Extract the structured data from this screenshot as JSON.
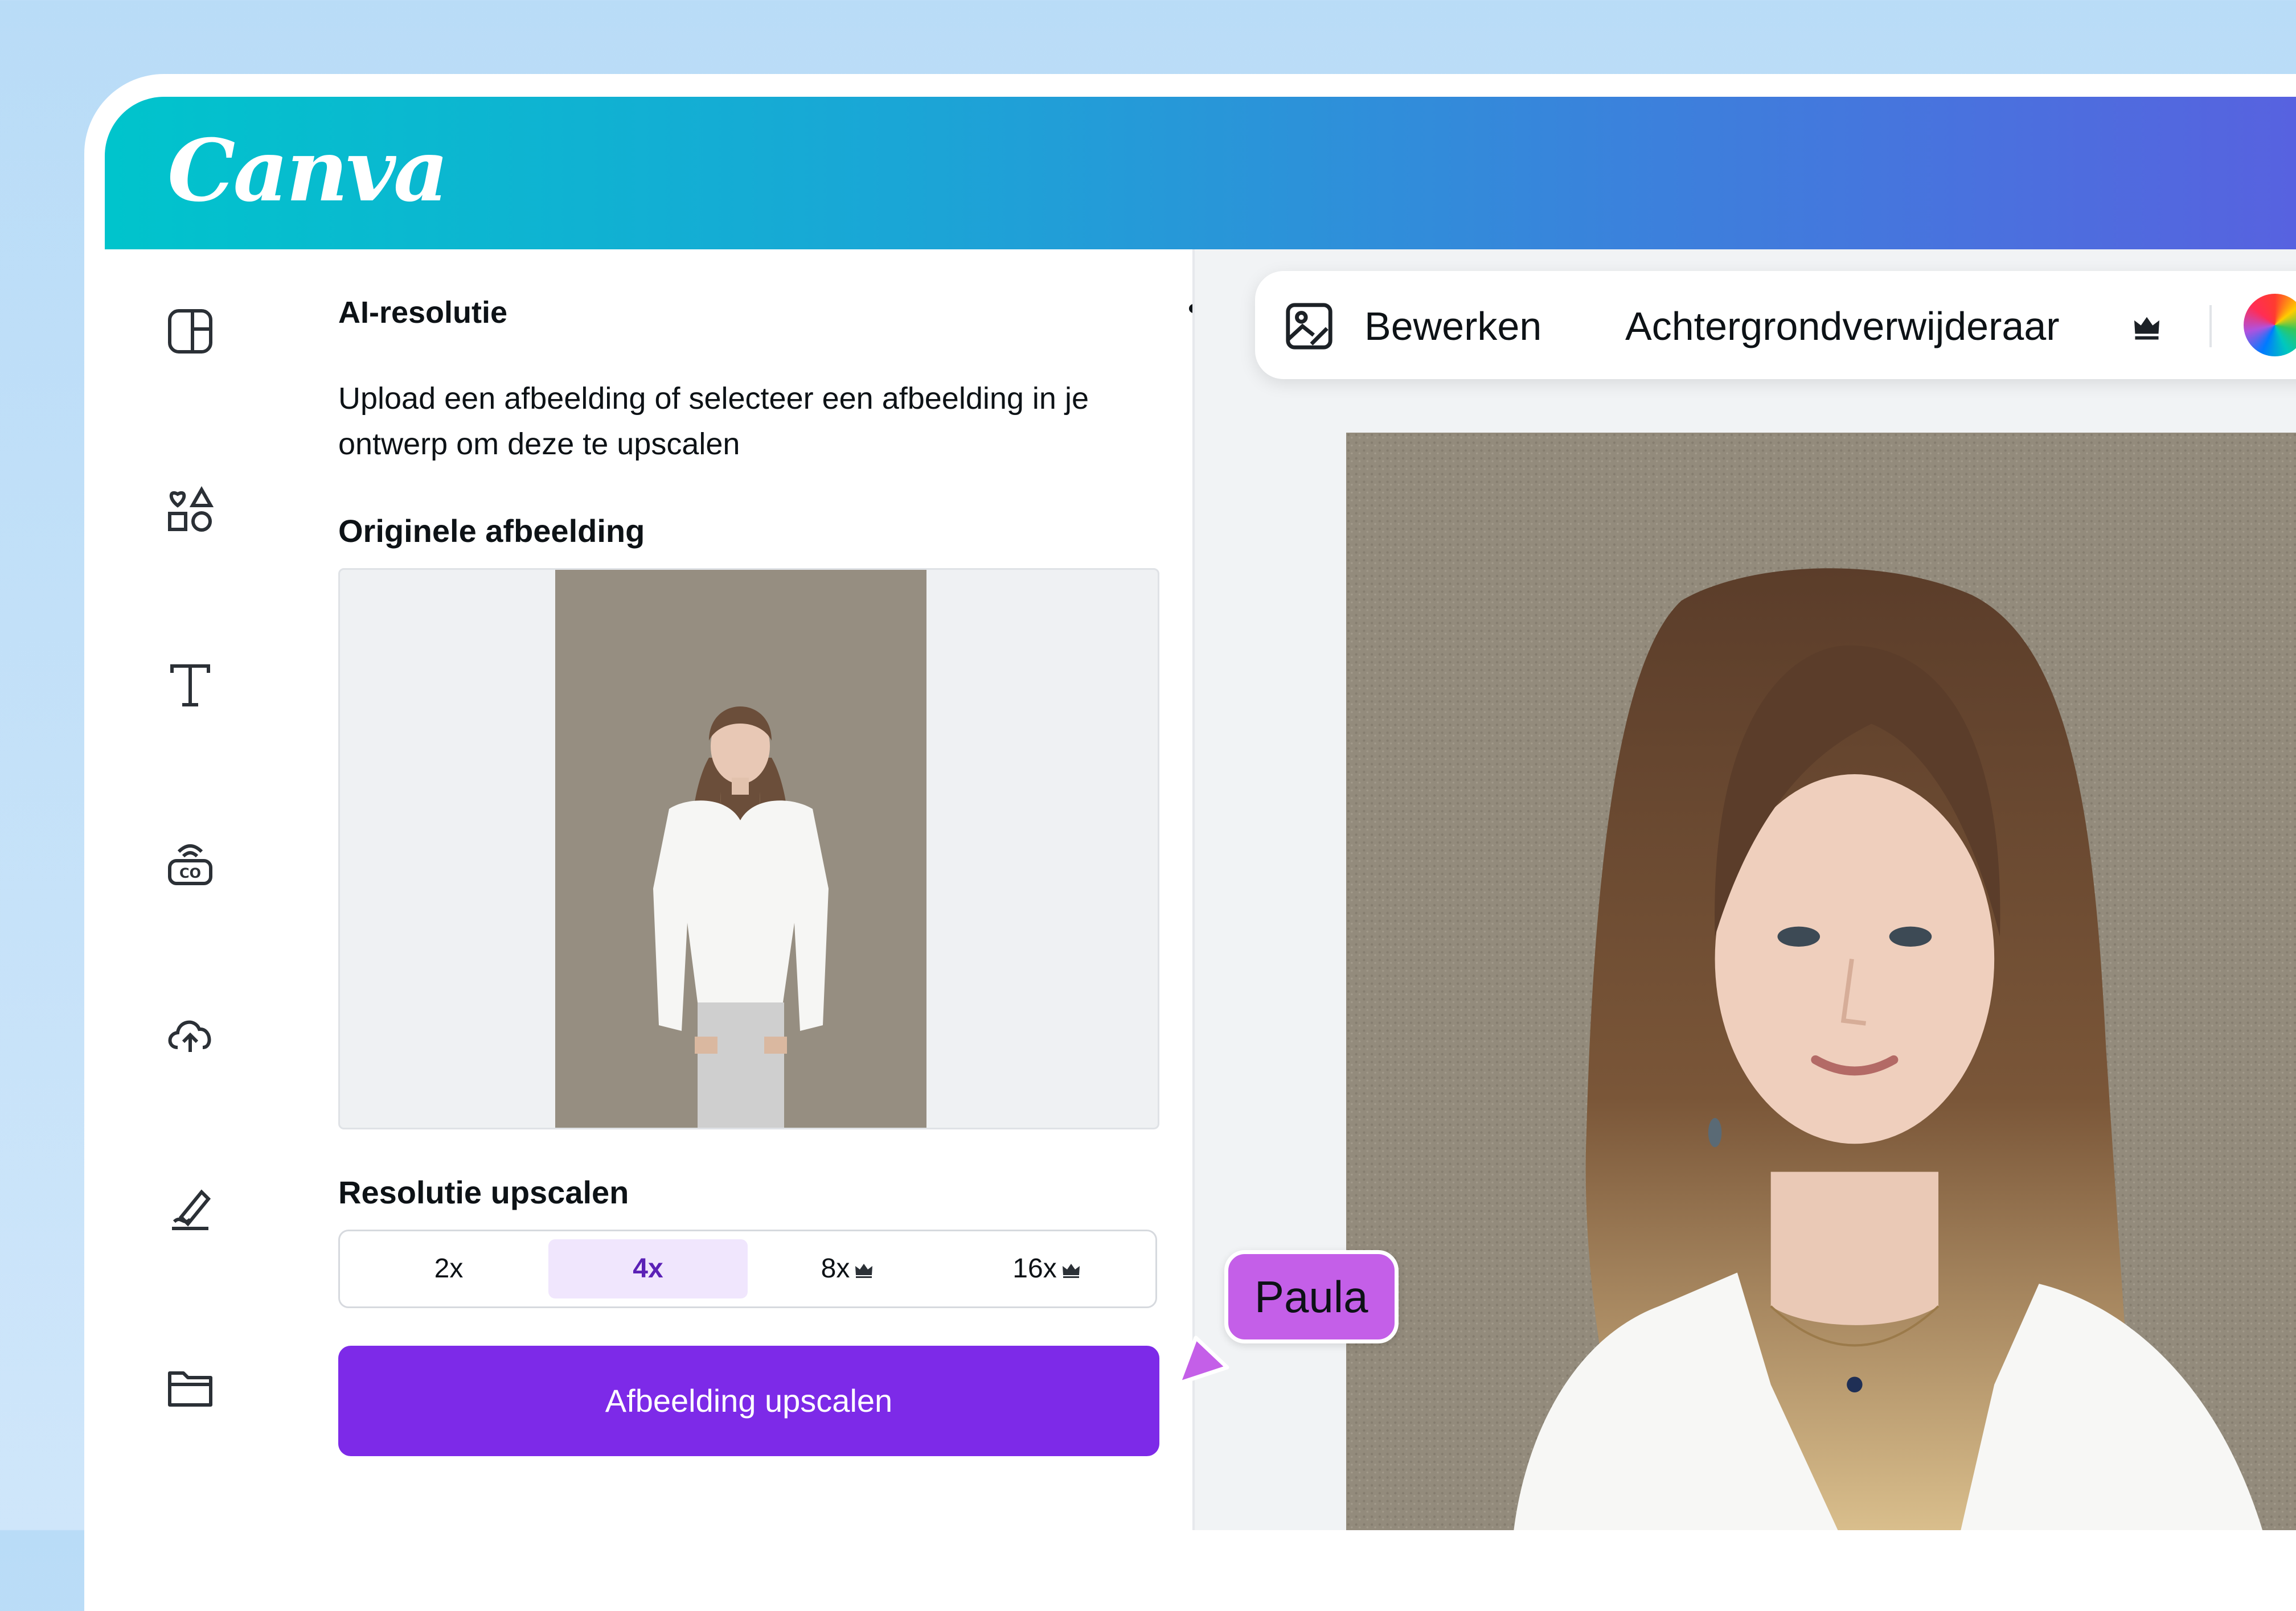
{
  "app": {
    "logo": "Canva"
  },
  "sidebar": {
    "items": [
      {
        "icon": "layout-icon"
      },
      {
        "icon": "elements-icon"
      },
      {
        "icon": "text-icon"
      },
      {
        "icon": "brand-icon"
      },
      {
        "icon": "upload-cloud-icon"
      },
      {
        "icon": "draw-icon"
      },
      {
        "icon": "folder-icon"
      }
    ]
  },
  "panel": {
    "title": "AI-resolutie",
    "description": "Upload een afbeelding of selecteer een afbeelding in je ontwerp om deze te upscalen",
    "original_label": "Originele afbeelding",
    "resolution_label": "Resolutie upscalen",
    "options": [
      {
        "label": "2x",
        "premium": false,
        "selected": false
      },
      {
        "label": "4x",
        "premium": false,
        "selected": true
      },
      {
        "label": "8x",
        "premium": true,
        "selected": false
      },
      {
        "label": "16x",
        "premium": true,
        "selected": false
      }
    ],
    "button_label": "Afbeelding upscalen"
  },
  "toolbar": {
    "edit_label": "Bewerken",
    "bg_remover_label": "Achtergrondverwijderaar"
  },
  "collaborator": {
    "name": "Paula",
    "color": "#c45fe8"
  },
  "colors": {
    "accent": "#7d2ae8",
    "selected_bg": "#f0e6fd",
    "header_start": "#00c4cc",
    "header_end": "#5a5fe0"
  }
}
